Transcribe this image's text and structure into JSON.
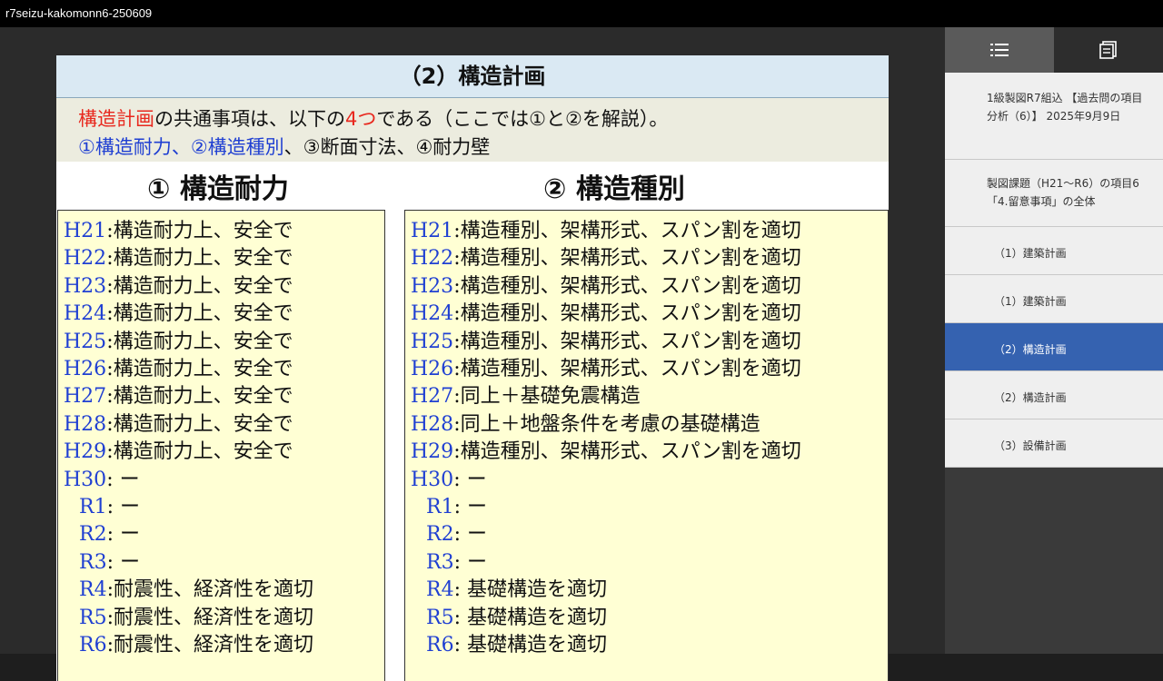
{
  "window": {
    "title": "r7seizu-kakomonn6-250609"
  },
  "slide": {
    "title": "（2）構造計画",
    "intro": {
      "line1": [
        {
          "text": "構造計画",
          "color": "red"
        },
        {
          "text": "の共通事項は、以下の",
          "color": "black"
        },
        {
          "text": "4つ",
          "color": "red"
        },
        {
          "text": "である（ここでは①と②を解説）。",
          "color": "black"
        }
      ],
      "line2": [
        {
          "text": "①構造耐力、②構造種別",
          "color": "blue"
        },
        {
          "text": "、③断面寸法、④耐力壁",
          "color": "black"
        }
      ]
    },
    "col1": {
      "heading": "① 構造耐力",
      "rows": [
        {
          "label": "H21",
          "text": ":構造耐力上、安全で"
        },
        {
          "label": "H22",
          "text": ":構造耐力上、安全で"
        },
        {
          "label": "H23",
          "text": ":構造耐力上、安全で"
        },
        {
          "label": "H24",
          "text": ":構造耐力上、安全で"
        },
        {
          "label": "H25",
          "text": ":構造耐力上、安全で"
        },
        {
          "label": "H26",
          "text": ":構造耐力上、安全で"
        },
        {
          "label": "H27",
          "text": ":構造耐力上、安全で"
        },
        {
          "label": "H28",
          "text": ":構造耐力上、安全で"
        },
        {
          "label": "H29",
          "text": ":構造耐力上、安全で"
        },
        {
          "label": "H30",
          "text": ":  ー"
        },
        {
          "label": "R1",
          "text": ":  ー",
          "indent": true
        },
        {
          "label": "R2",
          "text": ":  ー",
          "indent": true
        },
        {
          "label": "R3",
          "text": ":  ー",
          "indent": true
        },
        {
          "label": "R4",
          "text": ":耐震性、経済性を適切",
          "indent": true
        },
        {
          "label": "R5",
          "text": ":耐震性、経済性を適切",
          "indent": true
        },
        {
          "label": "R6",
          "text": ":耐震性、経済性を適切",
          "indent": true
        }
      ]
    },
    "col2": {
      "heading": "② 構造種別",
      "rows": [
        {
          "label": "H21",
          "text": ":構造種別、架構形式、スパン割を適切"
        },
        {
          "label": "H22",
          "text": ":構造種別、架構形式、スパン割を適切"
        },
        {
          "label": "H23",
          "text": ":構造種別、架構形式、スパン割を適切"
        },
        {
          "label": "H24",
          "text": ":構造種別、架構形式、スパン割を適切"
        },
        {
          "label": "H25",
          "text": ":構造種別、架構形式、スパン割を適切"
        },
        {
          "label": "H26",
          "text": ":構造種別、架構形式、スパン割を適切"
        },
        {
          "label": "H27",
          "text": ":同上＋基礎免震構造"
        },
        {
          "label": "H28",
          "text": ":同上＋地盤条件を考慮の基礎構造"
        },
        {
          "label": "H29",
          "text": ":構造種別、架構形式、スパン割を適切"
        },
        {
          "label": "H30",
          "text": ":  ー"
        },
        {
          "label": "R1",
          "text": ":  ー",
          "indent": true
        },
        {
          "label": "R2",
          "text": ":  ー",
          "indent": true
        },
        {
          "label": "R3",
          "text": ":  ー",
          "indent": true
        },
        {
          "label": "R4",
          "text": ": 基礎構造を適切",
          "indent": true
        },
        {
          "label": "R5",
          "text": ": 基礎構造を適切",
          "indent": true
        },
        {
          "label": "R6",
          "text": ": 基礎構造を適切",
          "indent": true
        }
      ]
    }
  },
  "sidebar": {
    "tabs": [
      {
        "icon": "list-icon",
        "active": true
      },
      {
        "icon": "notes-icon",
        "active": false
      }
    ],
    "items": [
      {
        "text": "1級製図R7組込 【過去問の項目分析（6）】 2025年9月9日",
        "selected": false
      },
      {
        "text": "製図課題（H21～R6）の項目6「4.留意事項」の全体",
        "selected": false
      },
      {
        "text": "（1）建築計画",
        "selected": false
      },
      {
        "text": "（1）建築計画",
        "selected": false
      },
      {
        "text": "（2）構造計画",
        "selected": true
      },
      {
        "text": "（2）構造計画",
        "selected": false
      },
      {
        "text": "（3）設備計画",
        "selected": false
      }
    ]
  },
  "colors": {
    "red": "#e8281e",
    "blue": "#1f3fd2",
    "highlight": "#3562b0",
    "panel": "#ffffd4"
  }
}
